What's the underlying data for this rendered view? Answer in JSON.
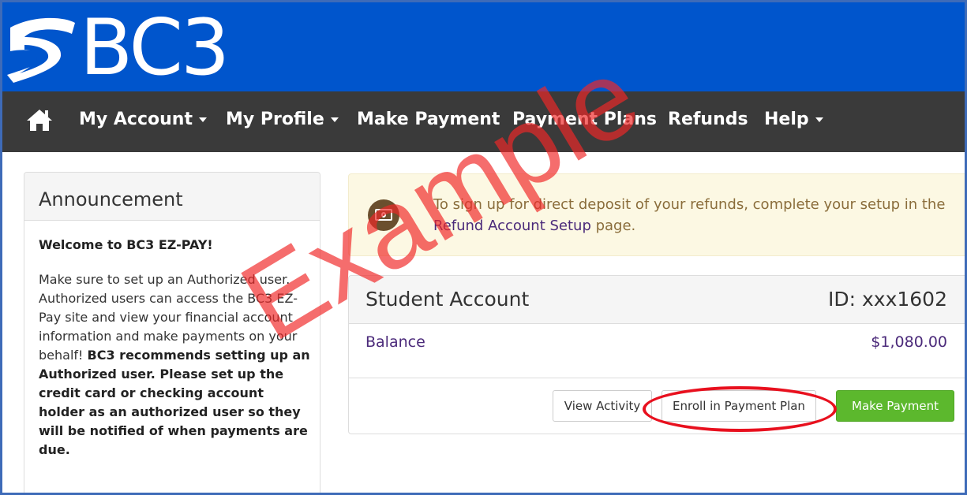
{
  "brand": {
    "logo_text": "BC3",
    "header_color": "#0055cc",
    "nav_color": "#3a3a3a"
  },
  "nav": {
    "home_icon": "home-icon",
    "items": [
      {
        "label": "My Account",
        "dropdown": true
      },
      {
        "label": "My Profile",
        "dropdown": true
      },
      {
        "label": "Make Payment",
        "dropdown": false
      },
      {
        "label": "Payment Plans",
        "dropdown": false
      },
      {
        "label": "Refunds",
        "dropdown": false
      },
      {
        "label": "Help",
        "dropdown": true
      }
    ]
  },
  "announcement": {
    "title": "Announcement",
    "welcome": "Welcome to BC3 EZ-PAY!",
    "body_normal": "Make sure to set up an Authorized user. Authorized users can access the BC3 EZ-Pay site and view your financial account information and make payments on your behalf! ",
    "body_bold": "BC3 recommends setting up an Authorized user. Please set up the credit card or checking account holder as an authorized user so they will be notified of when payments are due."
  },
  "alert": {
    "icon": "money-icon",
    "text": "To sign up for direct deposit of your refunds, complete your setup in the ",
    "link": "Refund Account Setup",
    "text_after": " page.",
    "background": "#fcf8e3"
  },
  "account": {
    "title": "Student Account",
    "id_label": "ID: xxx1602",
    "balance_label": "Balance",
    "balance_value": "$1,080.00",
    "buttons": {
      "view_activity": "View Activity",
      "enroll_plan": "Enroll in Payment Plan",
      "make_payment": "Make Payment"
    },
    "success_color": "#5cb82d"
  },
  "overlay": {
    "watermark": "Example",
    "highlight_color": "#e8101e"
  }
}
